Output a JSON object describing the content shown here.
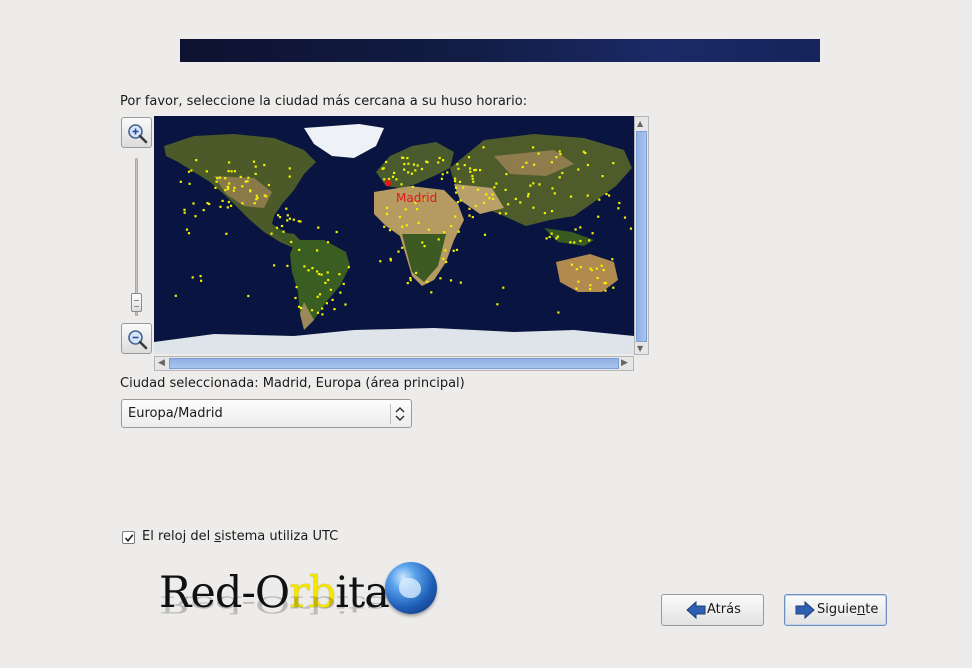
{
  "prompt": "Por favor, seleccione la ciudad más cercana a su huso horario:",
  "map": {
    "selected_city_marker": "Madrid",
    "marker_color": "#e01818",
    "city_dot_color": "#f2f200"
  },
  "selected": {
    "label": "Ciudad seleccionada: Madrid, Europa (área principal)"
  },
  "timezone_select": {
    "value": "Europa/Madrid"
  },
  "utc": {
    "checked": true,
    "label_before": "El reloj del ",
    "label_mnemonic": "s",
    "label_after": "istema utiliza UTC"
  },
  "logo": {
    "text_a": "Red-O",
    "text_b": "rb",
    "text_c": "ita"
  },
  "buttons": {
    "back_label": "Atrás",
    "next_before": "Siguie",
    "next_mnemonic": "n",
    "next_after": "te"
  },
  "colors": {
    "banner": "#121c45",
    "scroll_thumb": "#9dbbe8",
    "background": "#edeceb"
  }
}
